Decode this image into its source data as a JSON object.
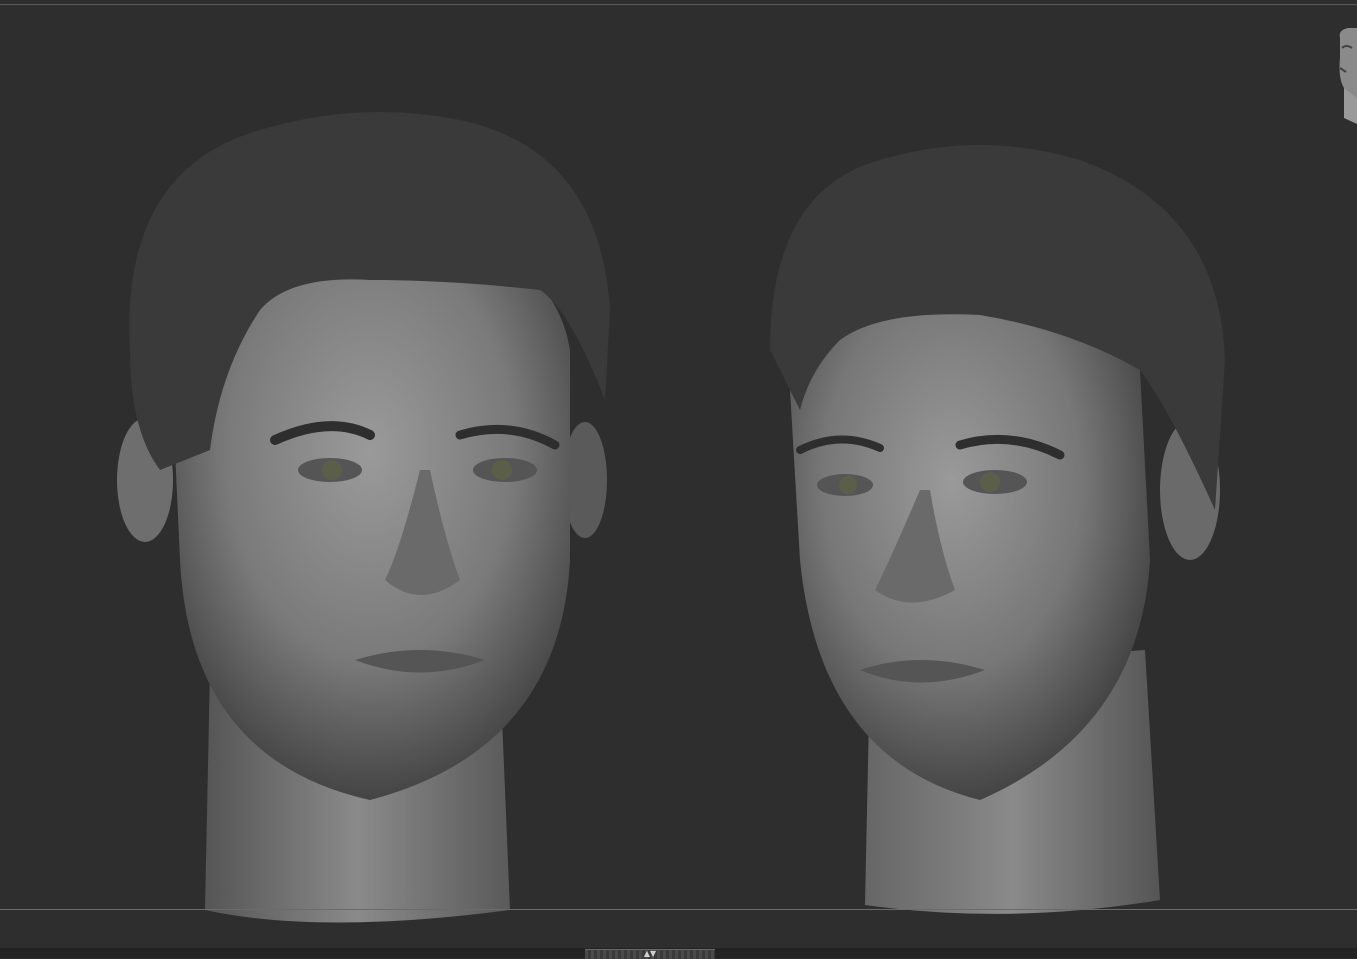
{
  "viewport": {
    "background": "#2e2e2e",
    "objects": [
      "sculpted-head-front-view",
      "sculpted-head-three-quarter-view"
    ]
  },
  "colors": {
    "hair": "#3a3a3a",
    "skin": "#8c8c8c",
    "skin_shadow": "#4a4a4a",
    "eyes": "#5b5f4a"
  },
  "icons": {
    "navigation_cube": "head-orientation-thumbnail",
    "scroll_handle": "up-down-arrows-icon"
  }
}
